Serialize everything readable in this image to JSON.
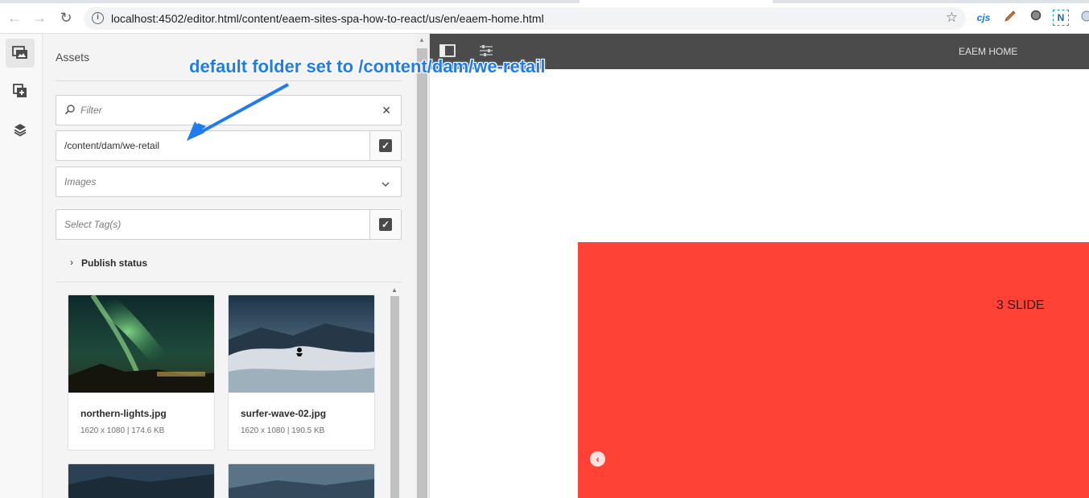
{
  "browser": {
    "url": "localhost:4502/editor.html/content/eaem-sites-spa-how-to-react/us/en/eaem-home.html",
    "extensions": [
      "cjs",
      "N"
    ]
  },
  "rail": {
    "items": [
      {
        "icon": "assets-icon",
        "active": true
      },
      {
        "icon": "components-icon",
        "active": false
      },
      {
        "icon": "content-tree-icon",
        "active": false
      }
    ]
  },
  "assets_panel": {
    "title": "Assets",
    "filter": {
      "placeholder": "Filter",
      "value": ""
    },
    "path": {
      "value": "/content/dam/we-retail"
    },
    "type_select": {
      "value": "Images"
    },
    "tags": {
      "placeholder": "Select Tag(s)"
    },
    "publish_status": "Publish status",
    "assets": [
      {
        "name": "northern-lights.jpg",
        "meta": "1620 x 1080 | 174.6 KB"
      },
      {
        "name": "surfer-wave-02.jpg",
        "meta": "1620 x 1080 | 190.5 KB"
      }
    ]
  },
  "editor": {
    "page_title": "EAEM HOME",
    "slide_label": "3 SLIDE"
  },
  "annotation": {
    "text": "default folder set to /content/dam/we-retail"
  },
  "colors": {
    "slide_bg": "#ff4136",
    "toolbar_bg": "#4b4b4b",
    "annotation": "#1e7bf0"
  }
}
